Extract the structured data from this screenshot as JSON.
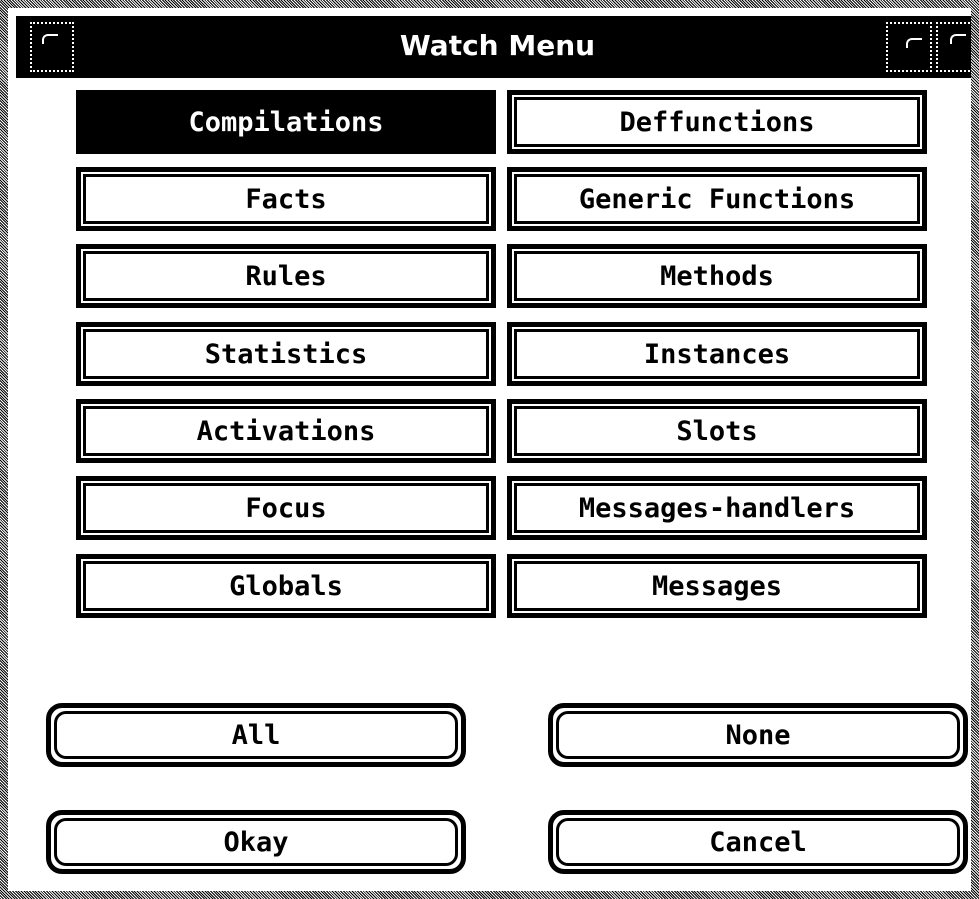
{
  "window": {
    "title": "Watch Menu"
  },
  "watch_items": [
    {
      "label": "Compilations",
      "selected": true
    },
    {
      "label": "Deffunctions",
      "selected": false
    },
    {
      "label": "Facts",
      "selected": false
    },
    {
      "label": "Generic Functions",
      "selected": false
    },
    {
      "label": "Rules",
      "selected": false
    },
    {
      "label": "Methods",
      "selected": false
    },
    {
      "label": "Statistics",
      "selected": false
    },
    {
      "label": "Instances",
      "selected": false
    },
    {
      "label": "Activations",
      "selected": false
    },
    {
      "label": "Slots",
      "selected": false
    },
    {
      "label": "Focus",
      "selected": false
    },
    {
      "label": "Messages-handlers",
      "selected": false
    },
    {
      "label": "Globals",
      "selected": false
    },
    {
      "label": "Messages",
      "selected": false
    }
  ],
  "actions": {
    "all_label": "All",
    "none_label": "None",
    "okay_label": "Okay",
    "cancel_label": "Cancel"
  },
  "colors": {
    "foreground": "#000000",
    "background": "#ffffff"
  }
}
